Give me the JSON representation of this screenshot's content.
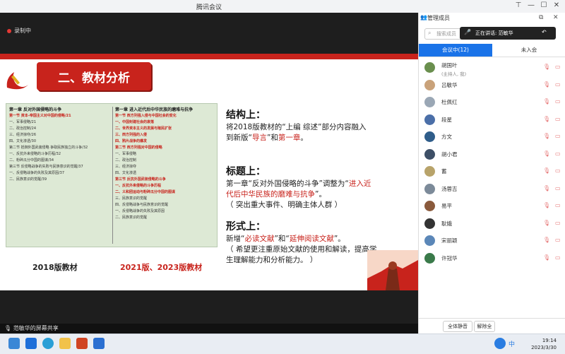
{
  "window": {
    "title": "腾讯会议",
    "controls": {
      "pin": "⊤",
      "minimize": "—",
      "maximize": "☐",
      "close": "✕"
    }
  },
  "recording": {
    "label": "录制中"
  },
  "slide": {
    "header": "二、教材分析",
    "book": {
      "left_column": [
        {
          "text": "第一章  反对外国侵略的斗争",
          "style": "ch"
        },
        {
          "text": "第一节  资本-帝国主义对中国的侵略/21",
          "style": "red"
        },
        {
          "text": "一、军事侵略/21",
          "style": ""
        },
        {
          "text": "二、政治控制/24",
          "style": ""
        },
        {
          "text": "三、经济掠夺/26",
          "style": ""
        },
        {
          "text": "四、文化渗透/30",
          "style": ""
        },
        {
          "text": "第二节  抵御外国武装侵略  争取民族独立的斗争/32",
          "style": ""
        },
        {
          "text": "一、反抗外来侵略的斗争历程/32",
          "style": ""
        },
        {
          "text": "二、粉碎瓜分中国的图谋/34",
          "style": ""
        },
        {
          "text": "第三节  反侵略战争的失败与民族意识的觉醒/37",
          "style": ""
        },
        {
          "text": "一、反侵略战争的失败及其原因/37",
          "style": ""
        },
        {
          "text": "二、民族意识的觉醒/39",
          "style": ""
        }
      ],
      "right_column": [
        {
          "text": "第一章  进入近代后中华民族的磨难与抗争",
          "style": "ch"
        },
        {
          "text": "第一节  西方列强入侵与中国社会的变化",
          "style": "red"
        },
        {
          "text": "一、中国封建社会的衰落",
          "style": "red"
        },
        {
          "text": "二、世界资本主义的发展与殖民扩张",
          "style": "red"
        },
        {
          "text": "三、西方列强的入侵",
          "style": "red"
        },
        {
          "text": "四、鸦片战争的爆发",
          "style": "red"
        },
        {
          "text": "第二节  西方列强对中国的侵略",
          "style": "red"
        },
        {
          "text": "一、军事侵略",
          "style": ""
        },
        {
          "text": "二、政治控制",
          "style": ""
        },
        {
          "text": "三、经济掠夺",
          "style": ""
        },
        {
          "text": "四、文化渗透",
          "style": ""
        },
        {
          "text": "第三节  反抗外国武装侵略的斗争",
          "style": "red"
        },
        {
          "text": "一、反抗外来侵略的斗争历程",
          "style": "red"
        },
        {
          "text": "二、义和团运动与粉碎瓜分中国的图谋",
          "style": "red"
        },
        {
          "text": "三、民族意识的觉醒",
          "style": ""
        },
        {
          "text": "四、反侵略战争与民族意识的觉醒",
          "style": ""
        },
        {
          "text": "一、反侵略战争的失败及其原因",
          "style": ""
        },
        {
          "text": "二、民族意识的觉醒",
          "style": ""
        }
      ]
    },
    "label_2018": "2018版教材",
    "label_2021": "2021版、2023版教材",
    "structure": {
      "heading": "结构上：",
      "line1": "将2018版教材的“上编 综述”部分内容融入",
      "line2_a": "到新版“",
      "line2_red1": "导言",
      "line2_b": "”和",
      "line2_red2": "第一章",
      "line2_c": "。"
    },
    "title_section": {
      "heading": "标题上：",
      "line1_a": "第一章“反对外国侵略的斗争”调整为“",
      "line1_red": "进入近",
      "line2_red": "代后中华民族的磨难与抗争",
      "line2_b": "”。",
      "line3": "（ 突出重大事件、明确主体人群 ）"
    },
    "form_section": {
      "heading": "形式上：",
      "line1_a": "新增“",
      "line1_red1": "必读文献",
      "line1_b": "”和“",
      "line1_red2": "延伸阅读文献",
      "line1_c": "”。",
      "line2": "（ 希望更注重原始文献的使用和解读，提高学",
      "line3": "生理解能力和分析能力。 ）"
    }
  },
  "bottom_bar": {
    "share_label": "范敏华的屏幕共享"
  },
  "panel": {
    "title": "管理成员",
    "search_placeholder": "搜索成员",
    "speaking": "正在讲话: 范敏华",
    "tab_in_meeting": "会议中(12)",
    "tab_not_joined": "未入会",
    "participants": [
      {
        "name": "胡国叶",
        "sub": "(主持人, 我)",
        "color": "#6a8f4e"
      },
      {
        "name": "吕敏华",
        "sub": "",
        "color": "#c9a27a"
      },
      {
        "name": "杜佩红",
        "sub": "",
        "color": "#9aa7b5"
      },
      {
        "name": "段星",
        "sub": "",
        "color": "#4b6fa8"
      },
      {
        "name": "方文",
        "sub": "",
        "color": "#2f5d8a"
      },
      {
        "name": "胡小君",
        "sub": "",
        "color": "#3d4f66"
      },
      {
        "name": "蓄",
        "sub": "",
        "color": "#b8a36a"
      },
      {
        "name": "汤蓉吉",
        "sub": "",
        "color": "#7c8a99"
      },
      {
        "name": "易平",
        "sub": "",
        "color": "#8a5a3c"
      },
      {
        "name": "耿娥",
        "sub": "",
        "color": "#333333"
      },
      {
        "name": "宋丽颖",
        "sub": "",
        "color": "#5b87b8"
      },
      {
        "name": "许冠华",
        "sub": "",
        "color": "#3a7a4a"
      }
    ],
    "mute_all": "全体静音",
    "unmute_all": "解除全"
  },
  "taskbar": {
    "ime": "中",
    "time": "19:14",
    "date": "2023/3/30"
  },
  "colors": {
    "accent": "#1a73e8",
    "slide_red": "#c8231c",
    "book_green": "#dde9d5"
  }
}
